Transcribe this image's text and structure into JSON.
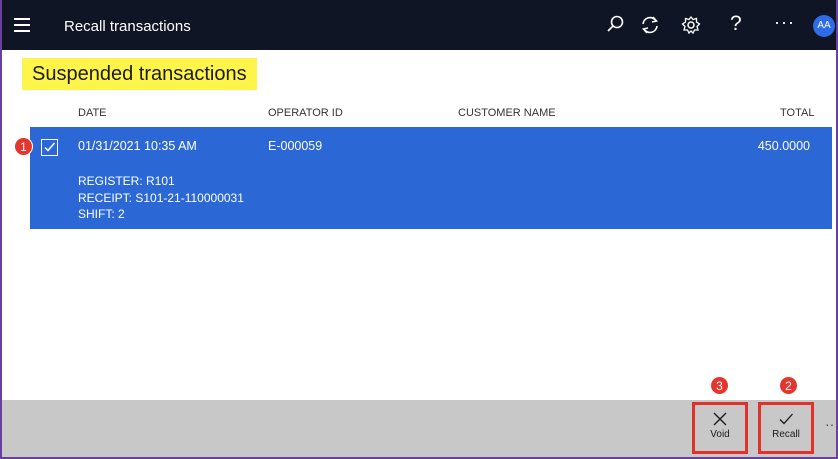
{
  "header": {
    "title": "Recall transactions",
    "avatar_initials": "AA",
    "help_glyph": "?",
    "more_glyph": "···",
    "icons": [
      "menu-icon",
      "search-icon",
      "refresh-icon",
      "settings-icon",
      "help-icon",
      "more-icon"
    ]
  },
  "page": {
    "section_title": "Suspended transactions"
  },
  "grid": {
    "columns": [
      "DATE",
      "OPERATOR ID",
      "CUSTOMER NAME",
      "TOTAL"
    ],
    "rows": [
      {
        "selected": true,
        "date": "01/31/2021 10:35 AM",
        "operator_id": "E-000059",
        "customer_name": "",
        "total": "450.0000",
        "register": "REGISTER: R101",
        "receipt": "RECEIPT: S101-21-110000031",
        "shift": "SHIFT: 2"
      }
    ]
  },
  "commands": {
    "void_label": "Void",
    "recall_label": "Recall",
    "more_glyph": "···"
  },
  "annotations": {
    "badge_1": "1",
    "badge_2": "2",
    "badge_3": "3"
  },
  "colors": {
    "header_bg": "#0f1524",
    "selected_row": "#2b68d6",
    "highlight": "#fff54a",
    "callout_red": "#e4352e",
    "command_bar": "#c8c8c8"
  }
}
